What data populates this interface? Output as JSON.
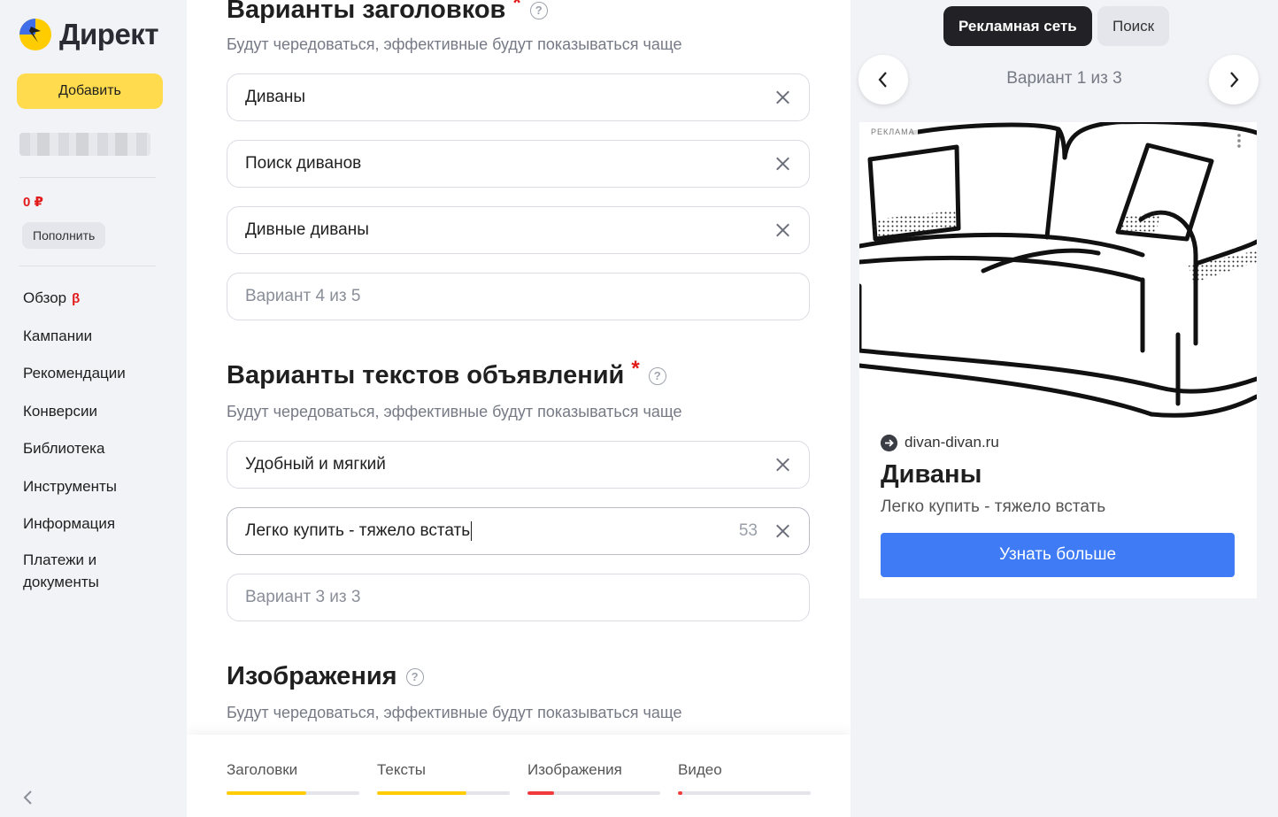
{
  "brand": {
    "name": "Директ"
  },
  "sidebar": {
    "add_label": "Добавить",
    "balance": "0 ₽",
    "topup_label": "Пополнить",
    "beta": "β",
    "items": [
      {
        "label": "Обзор"
      },
      {
        "label": "Кампании"
      },
      {
        "label": "Рекомендации"
      },
      {
        "label": "Конверсии"
      },
      {
        "label": "Библиотека"
      },
      {
        "label": "Инструменты"
      },
      {
        "label": "Информация"
      },
      {
        "label": "Платежи и документы"
      }
    ]
  },
  "main": {
    "headlines": {
      "title": "Варианты заголовков",
      "required": "*",
      "help": "?",
      "hint": "Будут чередоваться, эффективные будут показываться чаще",
      "fields": [
        "Диваны",
        "Поиск диванов",
        "Дивные диваны"
      ],
      "placeholder": "Вариант 4 из 5"
    },
    "texts": {
      "title": "Варианты текстов объявлений",
      "required": "*",
      "help": "?",
      "hint": "Будут чередоваться, эффективные будут показываться чаще",
      "fields": [
        "Удобный и мягкий",
        "Легко купить - тяжело встать"
      ],
      "active_count": "53",
      "placeholder": "Вариант 3 из 3"
    },
    "images": {
      "title": "Изображения",
      "help": "?",
      "hint": "Будут чередоваться, эффективные будут показываться чаще"
    },
    "progress": [
      {
        "label": "Заголовки",
        "fill": 0.6,
        "color": "#ffcc00"
      },
      {
        "label": "Тексты",
        "fill": 0.67,
        "color": "#ffcc00"
      },
      {
        "label": "Изображения",
        "fill": 0.2,
        "color": "#f33a3a"
      },
      {
        "label": "Видео",
        "fill": 0.03,
        "color": "#f33a3a"
      }
    ]
  },
  "preview": {
    "tab_network": "Рекламная сеть",
    "tab_search": "Поиск",
    "variant_label": "Вариант 1 из 3",
    "ad": {
      "tag": "РЕКЛАМА",
      "domain": "divan-divan.ru",
      "title": "Диваны",
      "text": "Легко купить - тяжело встать",
      "cta": "Узнать больше"
    }
  },
  "colors": {
    "accent_yellow": "#ffdb4d",
    "cta_blue": "#3e7bf5",
    "error_red": "#e21a1a"
  }
}
